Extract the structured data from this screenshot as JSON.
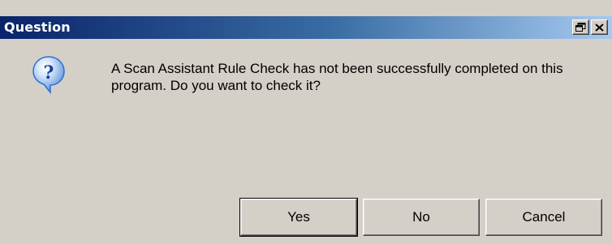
{
  "window": {
    "title": "Question",
    "icon": "question-icon"
  },
  "titlebar_buttons": {
    "restore_icon": "restore-window-icon",
    "close_icon": "close-icon"
  },
  "message": {
    "text": "A Scan Assistant Rule Check has not been successfully completed on this program. Do you want to check it?"
  },
  "buttons": {
    "yes": "Yes",
    "no": "No",
    "cancel": "Cancel"
  },
  "colors": {
    "dialog_background": "#d4d0c8",
    "titlebar_start": "#0a246a",
    "titlebar_end": "#a6caf0",
    "icon_bubble": "#2b6fd6"
  }
}
